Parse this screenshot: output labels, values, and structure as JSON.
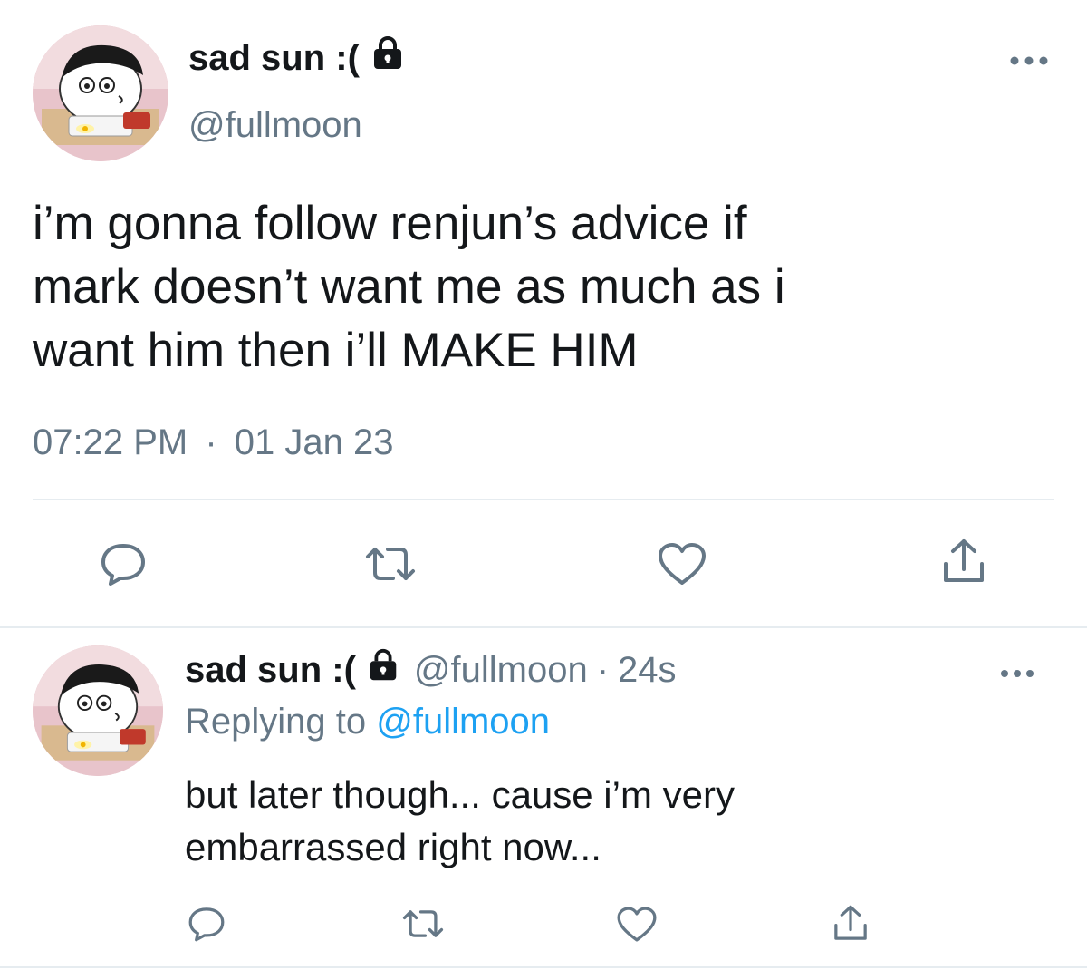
{
  "main_tweet": {
    "display_name": "sad sun :(",
    "handle": "@fullmoon",
    "text": "i’m gonna follow renjun’s advice if\nmark doesn’t want me as much as i\nwant him then i’ll MAKE HIM",
    "time": "07:22 PM",
    "separator": "·",
    "date": "01 Jan 23",
    "icons": {
      "protected": "lock-icon",
      "more": "more-icon",
      "reply": "reply-icon",
      "retweet": "retweet-icon",
      "like": "heart-icon",
      "share": "share-icon"
    }
  },
  "reply_tweet": {
    "display_name": "sad sun :(",
    "handle": "@fullmoon",
    "separator": "·",
    "time": "24s",
    "replying_prefix": "Replying to",
    "replying_mention": "@fullmoon",
    "text": "but later though... cause i’m very\nembarrassed right now..."
  },
  "colors": {
    "text_primary": "#14171a",
    "text_secondary": "#657786",
    "accent": "#1da1f2",
    "icon": "#657786",
    "divider": "#e6ecf0"
  }
}
